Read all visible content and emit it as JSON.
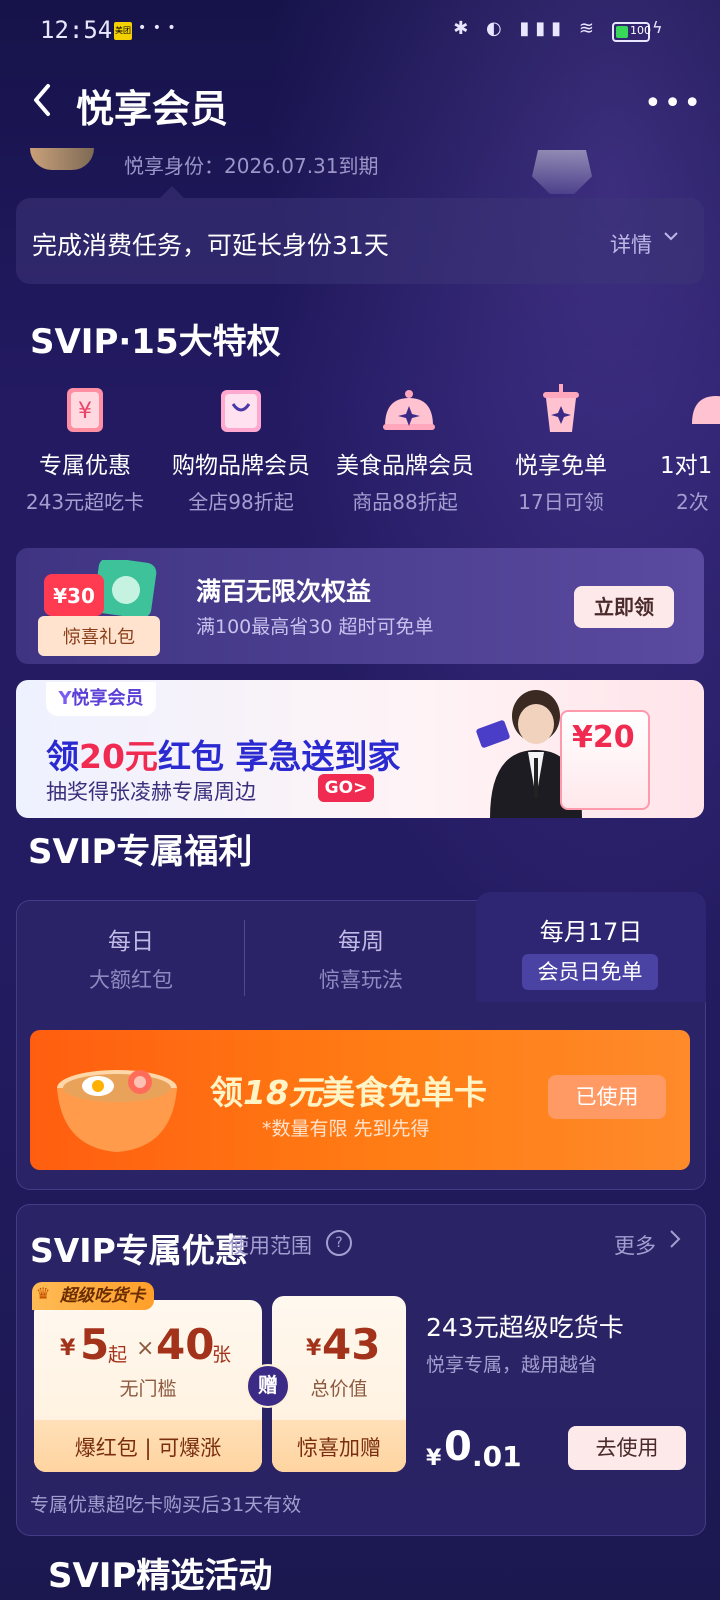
{
  "status_bar": {
    "time": "12:54",
    "app_badge": "美团",
    "battery": "100"
  },
  "nav": {
    "title": "悦享会员",
    "back_icon": "chevron-left",
    "more_icon": "ellipsis"
  },
  "identity": {
    "expiry": "悦享身份：2026.07.31到期"
  },
  "task": {
    "text": "完成消费任务，可延长身份31天",
    "detail": "详情"
  },
  "privileges": {
    "title": "SVIP·15大特权",
    "items": [
      {
        "name": "专属优惠",
        "sub": "243元超吃卡"
      },
      {
        "name": "购物品牌会员",
        "sub": "全店98折起"
      },
      {
        "name": "美食品牌会员",
        "sub": "商品88折起"
      },
      {
        "name": "悦享免单",
        "sub": "17日可领"
      },
      {
        "name": "1对1",
        "sub": "2次"
      }
    ]
  },
  "gift": {
    "title": "满百无限次权益",
    "sub": "满100最高省30 超时可免单",
    "button": "立即领",
    "badge_amount": "¥30",
    "badge_label": "惊喜礼包"
  },
  "ad": {
    "tag": "悦享会员",
    "line1_prefix": "领",
    "line1_amount": "20元",
    "line1_rest": "红包 享急送到家",
    "line2": "抽奖得张凌赫专属周边",
    "go": "GO>",
    "redpack": "¥20"
  },
  "welfare": {
    "title": "SVIP专属福利",
    "tabs": [
      {
        "title": "每日",
        "sub": "大额红包"
      },
      {
        "title": "每周",
        "sub": "惊喜玩法"
      },
      {
        "title": "每月17日",
        "sub": "会员日免单"
      }
    ],
    "active_tab_index": 2,
    "food_title_prefix": "领",
    "food_title_num": "18元",
    "food_title_rest": "美食免单卡",
    "food_sub": "*数量有限 先到先得",
    "food_button": "已使用"
  },
  "discount": {
    "title": "SVIP专属优惠",
    "scope": "使用范围",
    "more": "更多",
    "tag": "超级吃货卡",
    "card1": {
      "yen": "¥",
      "amount": "5",
      "qi": "起",
      "times": "×",
      "count": "40",
      "unit": "张",
      "sub": "无门槛",
      "foot": "爆红包 | 可爆涨"
    },
    "gift_label": "赠",
    "card2": {
      "yen": "¥",
      "amount": "43",
      "sub": "总价值",
      "foot": "惊喜加赠"
    },
    "info_title": "243元超级吃货卡",
    "info_sub": "悦享专属，越用越省",
    "price_yen": "¥",
    "price_main": "0",
    "price_dec": ".01",
    "button": "去使用",
    "note": "专属优惠超吃卡购买后31天有效"
  },
  "selected": {
    "title": "SVIP精选活动"
  }
}
